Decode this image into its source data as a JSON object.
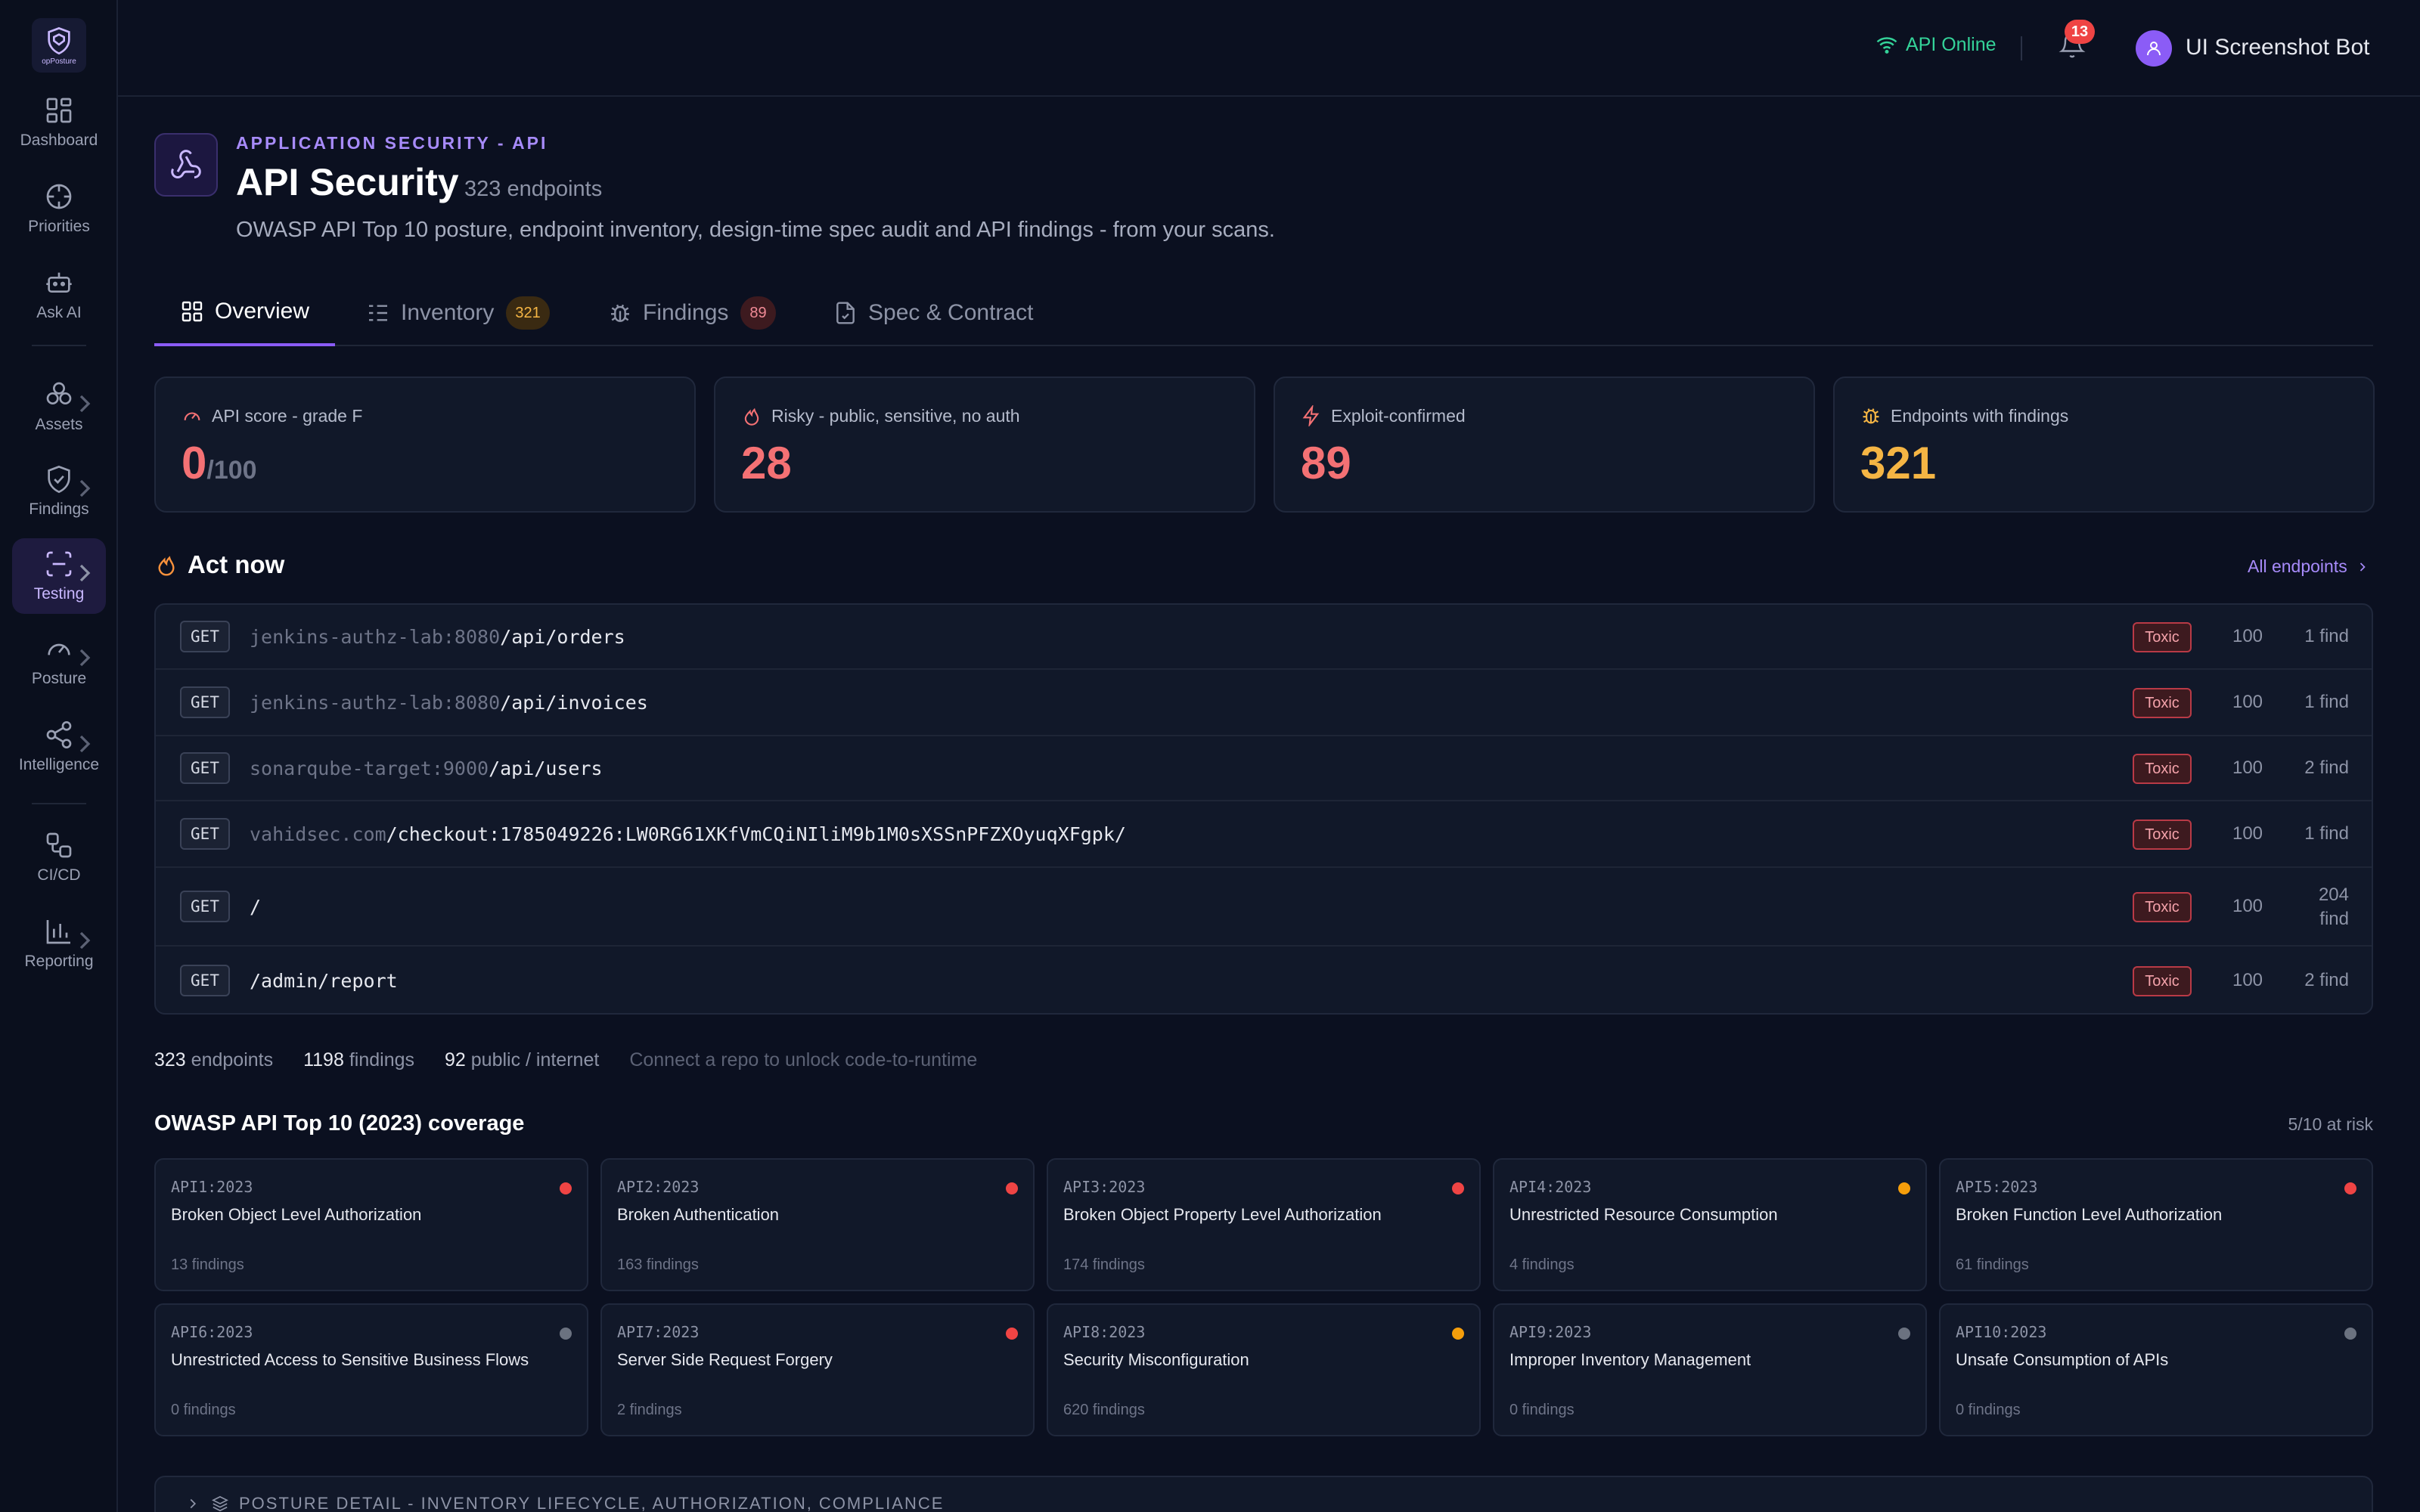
{
  "colors": {
    "accent": "#8b5cf6",
    "critical": "#ef4444",
    "warning": "#f59e0b",
    "neutral": "#6b7280",
    "online": "#34d399"
  },
  "brand": {
    "logo_text": "opPosture"
  },
  "sidebar": {
    "items": [
      {
        "label": "Dashboard",
        "icon": "grid-icon",
        "chevron": false,
        "active": false
      },
      {
        "label": "Priorities",
        "icon": "crosshair-icon",
        "chevron": false,
        "active": false
      },
      {
        "label": "Ask AI",
        "icon": "bot-icon",
        "chevron": false,
        "active": false
      },
      {
        "label": "Assets",
        "icon": "boxes-icon",
        "chevron": true,
        "active": false
      },
      {
        "label": "Findings",
        "icon": "shield-check-icon",
        "chevron": true,
        "active": false
      },
      {
        "label": "Testing",
        "icon": "scan-icon",
        "chevron": true,
        "active": true
      },
      {
        "label": "Posture",
        "icon": "gauge-icon",
        "chevron": true,
        "active": false
      },
      {
        "label": "Intelligence",
        "icon": "share-icon",
        "chevron": true,
        "active": false
      },
      {
        "label": "CI/CD",
        "icon": "workflow-icon",
        "chevron": false,
        "active": false
      },
      {
        "label": "Reporting",
        "icon": "bar-chart-icon",
        "chevron": true,
        "active": false
      }
    ]
  },
  "topbar": {
    "api_status": "API Online",
    "notifications": "13",
    "user": "UI Screenshot Bot"
  },
  "header": {
    "eyebrow": "APPLICATION SECURITY - API",
    "title": "API Security",
    "count": "323 endpoints",
    "description": "OWASP API Top 10 posture, endpoint inventory, design-time spec audit and API findings - from your scans."
  },
  "tabs": [
    {
      "label": "Overview",
      "icon": "grid-icon",
      "badge": ""
    },
    {
      "label": "Inventory",
      "icon": "list-icon",
      "badge": "321"
    },
    {
      "label": "Findings",
      "icon": "bug-icon",
      "badge": "89"
    },
    {
      "label": "Spec & Contract",
      "icon": "file-check-icon",
      "badge": ""
    }
  ],
  "kpis": [
    {
      "label": "API score - grade F",
      "value": "0",
      "suffix": "/100",
      "icon": "gauge-icon"
    },
    {
      "label": "Risky - public, sensitive, no auth",
      "value": "28",
      "suffix": "",
      "icon": "flame-icon"
    },
    {
      "label": "Exploit-confirmed",
      "value": "89",
      "suffix": "",
      "icon": "zap-icon"
    },
    {
      "label": "Endpoints with findings",
      "value": "321",
      "suffix": "",
      "icon": "bug-icon"
    }
  ],
  "act_now": {
    "title": "Act now",
    "link": "All endpoints",
    "rows": [
      {
        "method": "GET",
        "host": "jenkins-authz-lab:8080",
        "path": "/api/orders",
        "tag": "Toxic",
        "score": "100",
        "finds": "1 find"
      },
      {
        "method": "GET",
        "host": "jenkins-authz-lab:8080",
        "path": "/api/invoices",
        "tag": "Toxic",
        "score": "100",
        "finds": "1 find"
      },
      {
        "method": "GET",
        "host": "sonarqube-target:9000",
        "path": "/api/users",
        "tag": "Toxic",
        "score": "100",
        "finds": "2 find"
      },
      {
        "method": "GET",
        "host": "vahidsec.com",
        "path": "/checkout:1785049226:LW0RG61XKfVmCQiNIliM9b1M0sXSSnPFZXOyuqXFgpk/",
        "tag": "Toxic",
        "score": "100",
        "finds": "1 find"
      },
      {
        "method": "GET",
        "host": "",
        "path": "/",
        "tag": "Toxic",
        "score": "100",
        "finds": "204 find"
      },
      {
        "method": "GET",
        "host": "",
        "path": "/admin/report",
        "tag": "Toxic",
        "score": "100",
        "finds": "2 find"
      }
    ]
  },
  "stats": {
    "endpoints_num": "323",
    "endpoints_label": "endpoints",
    "findings_num": "1198",
    "findings_label": "findings",
    "public_num": "92",
    "public_label": "public / internet",
    "hint": "Connect a repo to unlock code-to-runtime"
  },
  "owasp": {
    "title": "OWASP API Top 10 (2023) coverage",
    "at_risk": "5/10 at risk",
    "items": [
      {
        "id": "API1:2023",
        "name": "Broken Object Level Authorization",
        "findings": "13 findings",
        "level": "critical"
      },
      {
        "id": "API2:2023",
        "name": "Broken Authentication",
        "findings": "163 findings",
        "level": "critical"
      },
      {
        "id": "API3:2023",
        "name": "Broken Object Property Level Authorization",
        "findings": "174 findings",
        "level": "critical"
      },
      {
        "id": "API4:2023",
        "name": "Unrestricted Resource Consumption",
        "findings": "4 findings",
        "level": "warning"
      },
      {
        "id": "API5:2023",
        "name": "Broken Function Level Authorization",
        "findings": "61 findings",
        "level": "critical"
      },
      {
        "id": "API6:2023",
        "name": "Unrestricted Access to Sensitive Business Flows",
        "findings": "0 findings",
        "level": "neutral"
      },
      {
        "id": "API7:2023",
        "name": "Server Side Request Forgery",
        "findings": "2 findings",
        "level": "critical"
      },
      {
        "id": "API8:2023",
        "name": "Security Misconfiguration",
        "findings": "620 findings",
        "level": "warning"
      },
      {
        "id": "API9:2023",
        "name": "Improper Inventory Management",
        "findings": "0 findings",
        "level": "neutral"
      },
      {
        "id": "API10:2023",
        "name": "Unsafe Consumption of APIs",
        "findings": "0 findings",
        "level": "neutral"
      }
    ]
  },
  "posture_detail": {
    "label": "POSTURE DETAIL - INVENTORY LIFECYCLE, AUTHORIZATION, COMPLIANCE"
  }
}
